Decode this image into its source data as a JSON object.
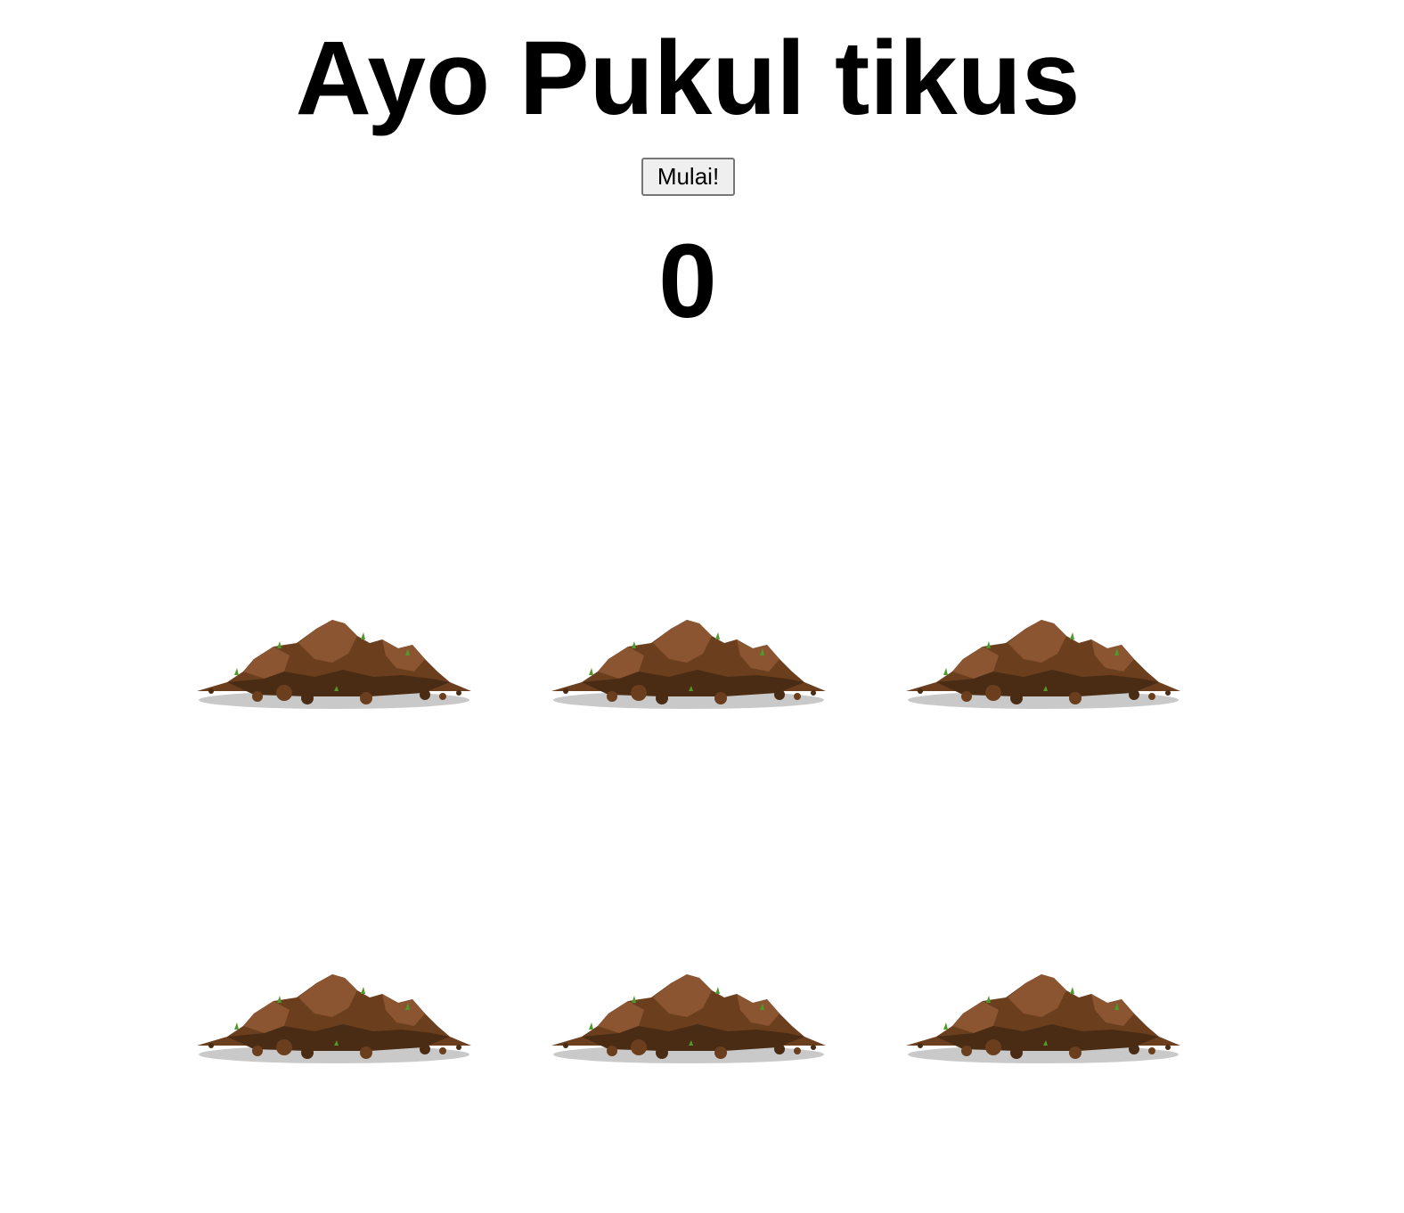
{
  "game": {
    "title": "Ayo Pukul tikus",
    "start_label": "Mulai!",
    "score": "0",
    "holes": [
      {
        "row": 1,
        "col": 1,
        "icon": "dirt-mound-icon"
      },
      {
        "row": 1,
        "col": 2,
        "icon": "dirt-mound-icon"
      },
      {
        "row": 1,
        "col": 3,
        "icon": "dirt-mound-icon"
      },
      {
        "row": 2,
        "col": 1,
        "icon": "dirt-mound-icon"
      },
      {
        "row": 2,
        "col": 2,
        "icon": "dirt-mound-icon"
      },
      {
        "row": 2,
        "col": 3,
        "icon": "dirt-mound-icon"
      }
    ]
  },
  "colors": {
    "dirt_dark": "#4a2c15",
    "dirt_mid": "#6b3f1e",
    "dirt_light": "#8a5530",
    "grass": "#4f9a2c",
    "shadow": "#c9c9c9"
  }
}
